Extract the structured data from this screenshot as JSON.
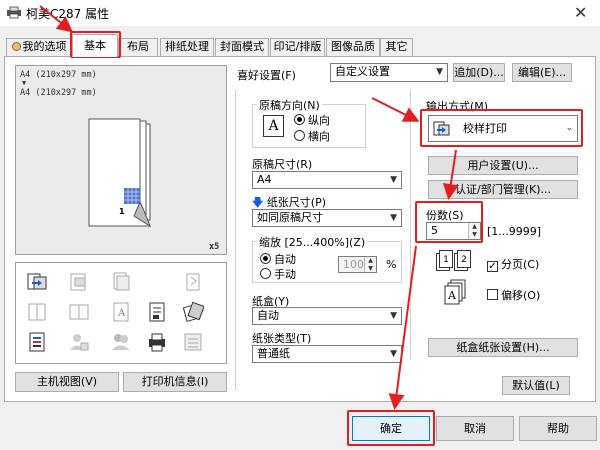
{
  "window": {
    "title": "柯美C287 属性",
    "close_glyph": "✕"
  },
  "tabs": [
    {
      "label": "我的选项",
      "active": false
    },
    {
      "label": "基本",
      "active": true
    },
    {
      "label": "布局",
      "active": false
    },
    {
      "label": "排纸处理",
      "active": false
    },
    {
      "label": "封面模式",
      "active": false
    },
    {
      "label": "印记/排版",
      "active": false
    },
    {
      "label": "图像品质",
      "active": false
    },
    {
      "label": "其它",
      "active": false
    }
  ],
  "preview": {
    "line1": "A4 (210x297 mm)",
    "arrow": "▼",
    "line2": "A4 (210x297 mm)",
    "copies_badge": "x5",
    "page_number": "1"
  },
  "left_buttons": {
    "printer_view": "主机视图(V)",
    "printer_info": "打印机信息(I)"
  },
  "favorites": {
    "label": "喜好设置(F)",
    "value": "自定义设置",
    "add": "追加(D)...",
    "edit": "编辑(E)..."
  },
  "orientation": {
    "label": "原稿方向(N)",
    "glyph": "A",
    "portrait": "纵向",
    "landscape": "横向",
    "selected": "portrait"
  },
  "original_size": {
    "label": "原稿尺寸(R)",
    "value": "A4"
  },
  "paper_size": {
    "label": "纸张尺寸(P)",
    "value": "如同原稿尺寸"
  },
  "zoom": {
    "label": "缩放 [25...400%](Z)",
    "auto": "自动",
    "manual": "手动",
    "value": "100",
    "unit": "%",
    "selected": "auto"
  },
  "paper_tray": {
    "label": "纸盒(Y)",
    "value": "自动"
  },
  "paper_type": {
    "label": "纸张类型(T)",
    "value": "普通纸"
  },
  "output": {
    "label": "输出方式(M)",
    "value": "校样打印",
    "user_settings": "用户设置(U)...",
    "auth": "认证/部门管理(K)..."
  },
  "copies": {
    "label": "份数(S)",
    "value": "5",
    "range": "[1...9999]",
    "collate": "分页(C)",
    "collate_checked": "✓",
    "offset": "偏移(O)",
    "collate_icon_labels": [
      "1",
      "2"
    ]
  },
  "tray_settings": "纸盒纸张设置(H)...",
  "defaults": "默认值(L)",
  "footer": {
    "ok": "确定",
    "cancel": "取消",
    "help": "帮助"
  },
  "colors": {
    "highlight_red": "#e02020",
    "accent_blue": "#1c5bd6"
  }
}
